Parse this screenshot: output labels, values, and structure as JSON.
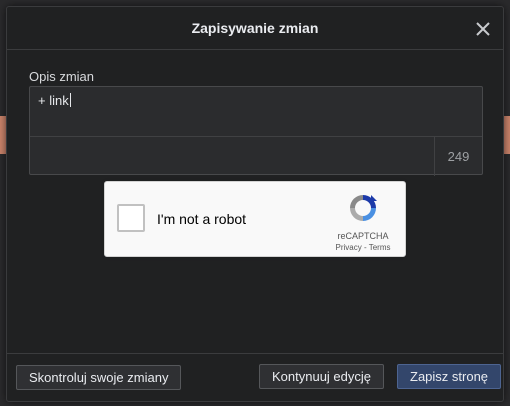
{
  "dialog": {
    "title": "Zapisywanie zmian",
    "close_icon": "close-icon"
  },
  "summary": {
    "label": "Opis zmian",
    "value": "+ link",
    "remaining_chars": "249"
  },
  "captcha": {
    "label": "I'm not a robot",
    "brand": "reCAPTCHA",
    "privacy": "Privacy",
    "separator": " - ",
    "terms": "Terms",
    "logo_icon": "recaptcha-logo-icon"
  },
  "footer": {
    "review_label": "Skontroluj swoje zmiany",
    "resume_label": "Kontynuuj edycję",
    "save_label": "Zapisz stronę"
  },
  "colors": {
    "primary_button": "#33466b",
    "dialog_bg": "#202122",
    "accent_strip": "#c9826a"
  }
}
